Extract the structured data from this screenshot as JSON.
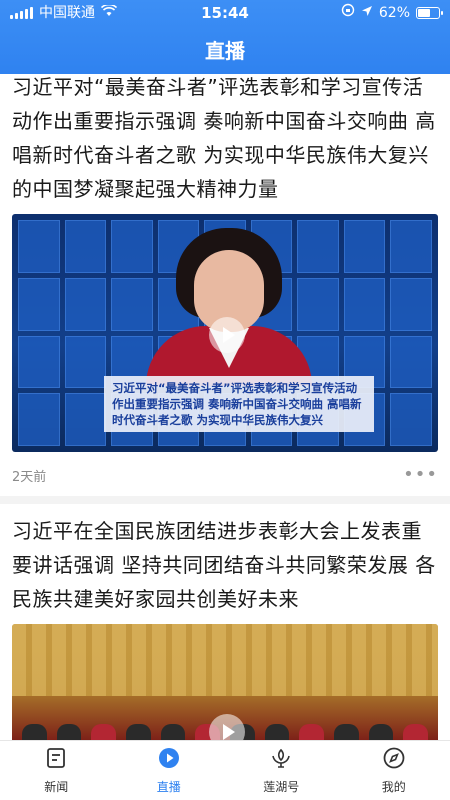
{
  "status_bar": {
    "carrier": "中国联通",
    "time": "15:44",
    "battery": "62%",
    "battery_level": 0.62
  },
  "header": {
    "title": "直播"
  },
  "feed": [
    {
      "title": "习近平对“最美奋斗者”评选表彰和学习宣传活动作出重要指示强调 奏响新中国奋斗交响曲 高唱新时代奋斗者之歌 为实现中华民族伟大复兴的中国梦凝聚起强大精神力量",
      "media_caption": "习近平对“最美奋斗者”评选表彰和学习宣传活动作出重要指示强调 奏响新中国奋斗交响曲 高唱新时代奋斗者之歌 为实现中华民族伟大复兴",
      "time": "2天前",
      "more": "•••"
    },
    {
      "title": "习近平在全国民族团结进步表彰大会上发表重要讲话强调 坚持共同团结奋斗共同繁荣发展 各民族共建美好家园共创美好未来"
    }
  ],
  "tabbar": {
    "items": [
      {
        "label": "新闻",
        "icon": "news-icon"
      },
      {
        "label": "直播",
        "icon": "live-play-icon"
      },
      {
        "label": "莲湖号",
        "icon": "lotus-icon"
      },
      {
        "label": "我的",
        "icon": "compass-icon"
      }
    ],
    "active_color": "#2f82f0"
  },
  "colors": {
    "header_bg": "#2f82f0",
    "accent": "#2f82f0"
  }
}
